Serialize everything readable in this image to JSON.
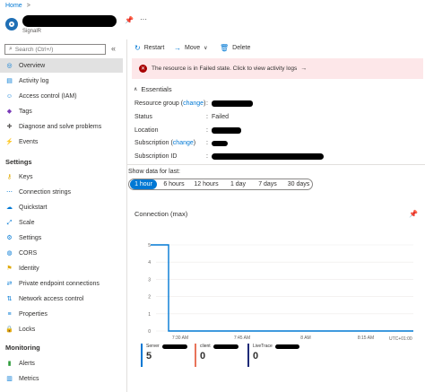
{
  "breadcrumb": {
    "home": "Home",
    "separator": ">"
  },
  "resource": {
    "type": "SignalR"
  },
  "search": {
    "placeholder": "Search (Ctrl+/)"
  },
  "nav": {
    "items": [
      {
        "label": "Overview",
        "icon": "overview-icon"
      },
      {
        "label": "Activity log",
        "icon": "activity-log-icon"
      },
      {
        "label": "Access control (IAM)",
        "icon": "iam-icon"
      },
      {
        "label": "Tags",
        "icon": "tag-icon"
      },
      {
        "label": "Diagnose and solve problems",
        "icon": "wrench-icon"
      },
      {
        "label": "Events",
        "icon": "lightning-icon"
      }
    ],
    "settings_header": "Settings",
    "settings": [
      {
        "label": "Keys",
        "icon": "key-icon"
      },
      {
        "label": "Connection strings",
        "icon": "connection-strings-icon"
      },
      {
        "label": "Quickstart",
        "icon": "cloud-icon"
      },
      {
        "label": "Scale",
        "icon": "scale-icon"
      },
      {
        "label": "Settings",
        "icon": "gear-icon"
      },
      {
        "label": "CORS",
        "icon": "cors-icon"
      },
      {
        "label": "Identity",
        "icon": "identity-icon"
      },
      {
        "label": "Private endpoint connections",
        "icon": "endpoint-icon"
      },
      {
        "label": "Network access control",
        "icon": "network-icon"
      },
      {
        "label": "Properties",
        "icon": "properties-icon"
      },
      {
        "label": "Locks",
        "icon": "lock-icon"
      }
    ],
    "monitoring_header": "Monitoring",
    "monitoring": [
      {
        "label": "Alerts",
        "icon": "alert-icon"
      },
      {
        "label": "Metrics",
        "icon": "metrics-icon"
      }
    ]
  },
  "toolbar": {
    "restart": "Restart",
    "move": "Move",
    "delete": "Delete"
  },
  "banner": {
    "message": "The resource is in Failed state. Click to view activity logs",
    "arrow": "→"
  },
  "essentials": {
    "title": "Essentials",
    "resource_group_label": "Resource group (",
    "change": "change",
    "close_paren": ")",
    "status_label": "Status",
    "status_value": "Failed",
    "location_label": "Location",
    "subscription_label": "Subscription (",
    "subscription_id_label": "Subscription ID",
    "colon": ":"
  },
  "time_range": {
    "label": "Show data for last:",
    "options": [
      "1 hour",
      "6 hours",
      "12 hours",
      "1 day",
      "7 days",
      "30 days"
    ],
    "selected": 0
  },
  "chart_data": {
    "type": "line",
    "title": "Connection (max)",
    "y_ticks": [
      "5",
      "4",
      "3",
      "2",
      "1",
      "0"
    ],
    "x_ticks": [
      "7:30 AM",
      "7:45 AM",
      "8 AM",
      "8:15 AM"
    ],
    "timezone": "UTC+01:00",
    "ylim": [
      0,
      5
    ],
    "x": [
      "start",
      "7:25 AM",
      "7:25 AM",
      "end"
    ],
    "y": [
      5,
      5,
      0,
      0
    ],
    "series_color": "#0078d4",
    "legend": [
      {
        "name": "Server",
        "value": "5",
        "color": "#0078d4"
      },
      {
        "name": "client",
        "value": "0",
        "color": "#e8735a"
      },
      {
        "name": "LiveTrace",
        "value": "0",
        "color": "#1e2a78"
      }
    ]
  },
  "colors": {
    "accent": "#0078d4",
    "error": "#a80000",
    "error_bg": "#fde7e9",
    "selected_nav": "#e1e1e1"
  }
}
